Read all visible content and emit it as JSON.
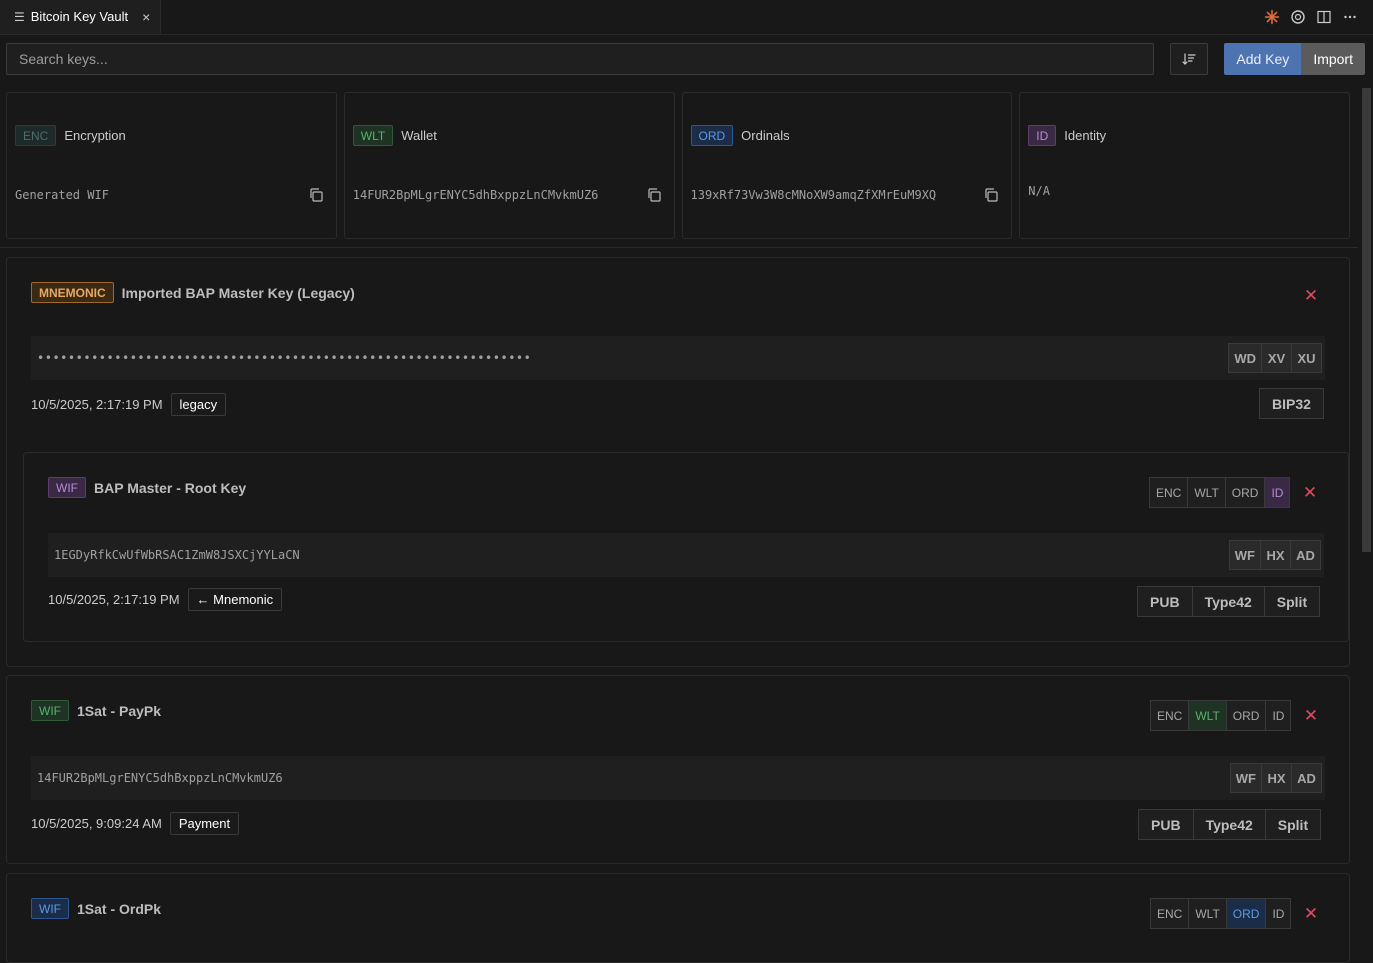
{
  "tab": {
    "title": "Bitcoin Key Vault",
    "close": "×"
  },
  "title_icons": [
    "claude-icon",
    "openai-icon",
    "split-editor-icon",
    "more-icon"
  ],
  "toolbar": {
    "search_placeholder": "Search keys...",
    "add_label": "Add Key",
    "import_label": "Import"
  },
  "summary": [
    {
      "badge": "ENC",
      "title": "Encryption",
      "value": "Generated WIF",
      "copy": true
    },
    {
      "badge": "WLT",
      "title": "Wallet",
      "value": "14FUR2BpMLgrENYC5dhBxppzLnCMvkmUZ6",
      "copy": true
    },
    {
      "badge": "ORD",
      "title": "Ordinals",
      "value": "139xRf73Vw3W8cMNoXW9amqZfXMrEuM9XQ",
      "copy": true
    },
    {
      "badge": "ID",
      "title": "Identity",
      "value": "N/A",
      "copy": false
    }
  ],
  "mnemonic_card": {
    "badge": "MNEMONIC",
    "title": "Imported BAP Master Key (Legacy)",
    "masked": "••••••••••••••••••••••••••••••••••••••••••••••••••••••••••••••••",
    "formats": [
      "WD",
      "XV",
      "XU"
    ],
    "date": "10/5/2025, 2:17:19 PM",
    "tag": "legacy",
    "action": "BIP32"
  },
  "child_card": {
    "badge": "WIF",
    "title": "BAP Master - Root Key",
    "roles": [
      "ENC",
      "WLT",
      "ORD",
      "ID"
    ],
    "active_role": "ID",
    "key": "1EGDyRfkCwUfWbRSAC1ZmW8JSXCjYYLaCN",
    "formats": [
      "WF",
      "HX",
      "AD"
    ],
    "date": "10/5/2025, 2:17:19 PM",
    "tag": "← Mnemonic",
    "actions": [
      "PUB",
      "Type42",
      "Split"
    ]
  },
  "paypk_card": {
    "badge": "WIF",
    "title": "1Sat - PayPk",
    "roles": [
      "ENC",
      "WLT",
      "ORD",
      "ID"
    ],
    "active_role": "WLT",
    "key": "14FUR2BpMLgrENYC5dhBxppzLnCMvkmUZ6",
    "formats": [
      "WF",
      "HX",
      "AD"
    ],
    "date": "10/5/2025, 9:09:24 AM",
    "tag": "Payment",
    "actions": [
      "PUB",
      "Type42",
      "Split"
    ]
  },
  "ordpk_card": {
    "badge": "WIF",
    "title": "1Sat - OrdPk",
    "roles": [
      "ENC",
      "WLT",
      "ORD",
      "ID"
    ],
    "active_role": "ORD"
  },
  "close_glyph": "✕"
}
